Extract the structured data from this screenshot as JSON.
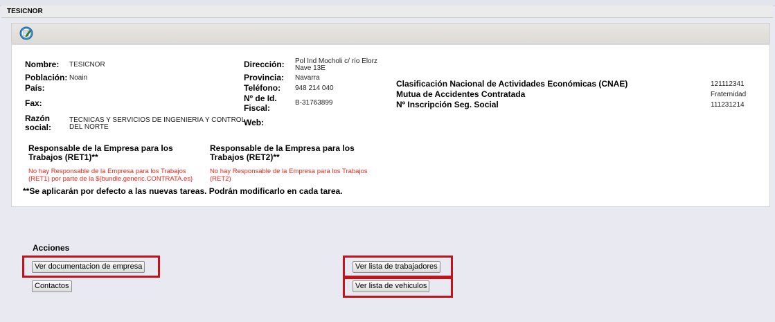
{
  "window": {
    "title": "TESICNOR"
  },
  "toolbar": {
    "edit_icon": "edit-document-icon"
  },
  "company": {
    "nombre_label": "Nombre:",
    "nombre": "TESICNOR",
    "poblacion_label": "Población:",
    "poblacion": "Noain",
    "pais_label": "País:",
    "pais": "",
    "fax_label": "Fax:",
    "fax": "",
    "razon_label_1": "Razón",
    "razon_label_2": "social:",
    "razon_1": "TECNICAS Y SERVICIOS DE INGENIERIA Y CONTROL",
    "razon_2": "DEL NORTE",
    "direccion_label": "Dirección:",
    "direccion_1": "Pol Ind Mocholi c/ río Elorz",
    "direccion_2": "Nave 13E",
    "provincia_label": "Provincia:",
    "provincia": "Navarra",
    "telefono_label": "Teléfono:",
    "telefono": "948 214 040",
    "nif_label_1": "Nº de Id.",
    "nif_label_2": "Fiscal:",
    "nif": "B-31763899",
    "web_label": "Web:",
    "web": ""
  },
  "classification": {
    "cnae_label": "Clasificación Nacional de Actividades Económicas (CNAE)",
    "cnae": "121112341",
    "mutua_label": "Mutua de Accidentes Contratada",
    "mutua": "Fraternidad",
    "ss_label": "Nº Inscripción Seg. Social",
    "ss": "111231214"
  },
  "ret1": {
    "title_1": "Responsable de la Empresa para los",
    "title_2": "Trabajos (RET1)**",
    "msg_1": "No hay Responsable de la Empresa para los Trabajos",
    "msg_2": "(RET1) por parte de la ${bundle.generic.CONTRATA.es}"
  },
  "ret2": {
    "title_1": "Responsable de la Empresa para los",
    "title_2": "Trabajos (RET2)**",
    "msg_1": "No hay Responsable de la Empresa para los Trabajos",
    "msg_2": "(RET2)"
  },
  "note": "**Se aplicarán por defecto a las nuevas tareas. Podrán modificarlo en cada tarea.",
  "actions": {
    "title": "Acciones",
    "ver_documentacion": "Ver documentacion de empresa",
    "contactos": "Contactos",
    "ver_trabajadores": "Ver lista de trabajadores",
    "ver_vehiculos": "Ver lista de vehiculos"
  },
  "colors": {
    "highlight": "#c0131b",
    "error_text": "#e8271c",
    "background": "#e9e9f2"
  }
}
